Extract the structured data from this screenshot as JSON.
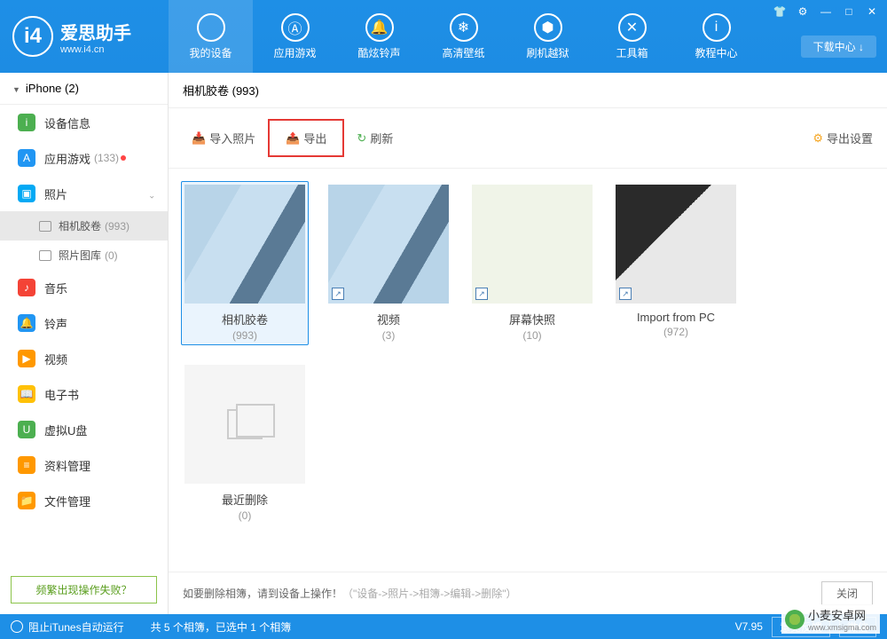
{
  "app": {
    "name_cn": "爱思助手",
    "name_en": "www.i4.cn",
    "logo_letter": "i4"
  },
  "win": {
    "download_center": "下载中心 ↓"
  },
  "nav": [
    {
      "label": "我的设备",
      "icon": ""
    },
    {
      "label": "应用游戏",
      "icon": "Ⓐ"
    },
    {
      "label": "酷炫铃声",
      "icon": "🔔"
    },
    {
      "label": "高清壁纸",
      "icon": "❄"
    },
    {
      "label": "刷机越狱",
      "icon": "⬢"
    },
    {
      "label": "工具箱",
      "icon": "✕"
    },
    {
      "label": "教程中心",
      "icon": "i"
    }
  ],
  "device_header": "iPhone (2)",
  "sidebar": [
    {
      "label": "设备信息",
      "color": "#4caf50",
      "icon": "i"
    },
    {
      "label": "应用游戏",
      "color": "#2196f3",
      "icon": "A",
      "badge": "(133)",
      "dot": true
    },
    {
      "label": "照片",
      "color": "#03a9f4",
      "icon": "▣",
      "expanded": true
    },
    {
      "label": "音乐",
      "color": "#f44336",
      "icon": "♪"
    },
    {
      "label": "铃声",
      "color": "#2196f3",
      "icon": "🔔"
    },
    {
      "label": "视频",
      "color": "#ff9800",
      "icon": "▶"
    },
    {
      "label": "电子书",
      "color": "#ffc107",
      "icon": "📖"
    },
    {
      "label": "虚拟U盘",
      "color": "#4caf50",
      "icon": "U"
    },
    {
      "label": "资料管理",
      "color": "#ff9800",
      "icon": "≡"
    },
    {
      "label": "文件管理",
      "color": "#ff9800",
      "icon": "📁"
    }
  ],
  "photo_subs": [
    {
      "label": "相机胶卷",
      "count": "(993)",
      "active": true
    },
    {
      "label": "照片图库",
      "count": "(0)"
    }
  ],
  "faq": "频繁出现操作失败？",
  "breadcrumb": "相机胶卷 (993)",
  "toolbar": {
    "import": "导入照片",
    "export": "导出",
    "refresh": "刷新",
    "settings": "导出设置"
  },
  "albums": [
    {
      "name": "相机胶卷",
      "count": "(993)",
      "thumb": "photo",
      "selected": true
    },
    {
      "name": "视频",
      "count": "(3)",
      "thumb": "photo",
      "shortcut": true
    },
    {
      "name": "屏幕快照",
      "count": "(10)",
      "thumb": "map",
      "shortcut": true
    },
    {
      "name": "Import from PC",
      "count": "(972)",
      "thumb": "laptop",
      "shortcut": true
    },
    {
      "name": "最近删除",
      "count": "(0)",
      "thumb": "empty"
    }
  ],
  "hint": {
    "main": "如要删除相簿，请到设备上操作！",
    "gray": "（\"设备->照片->相簿->编辑->删除\"）",
    "close": "关闭"
  },
  "status": {
    "itunes": "阻止iTunes自动运行",
    "center": "共 5 个相簿，已选中 1 个相簿",
    "version": "V7.95",
    "feedback": "意见反馈",
    "wechat": "微信"
  },
  "watermark": {
    "title": "小麦安卓网",
    "sub": "www.xmsigma.com"
  }
}
